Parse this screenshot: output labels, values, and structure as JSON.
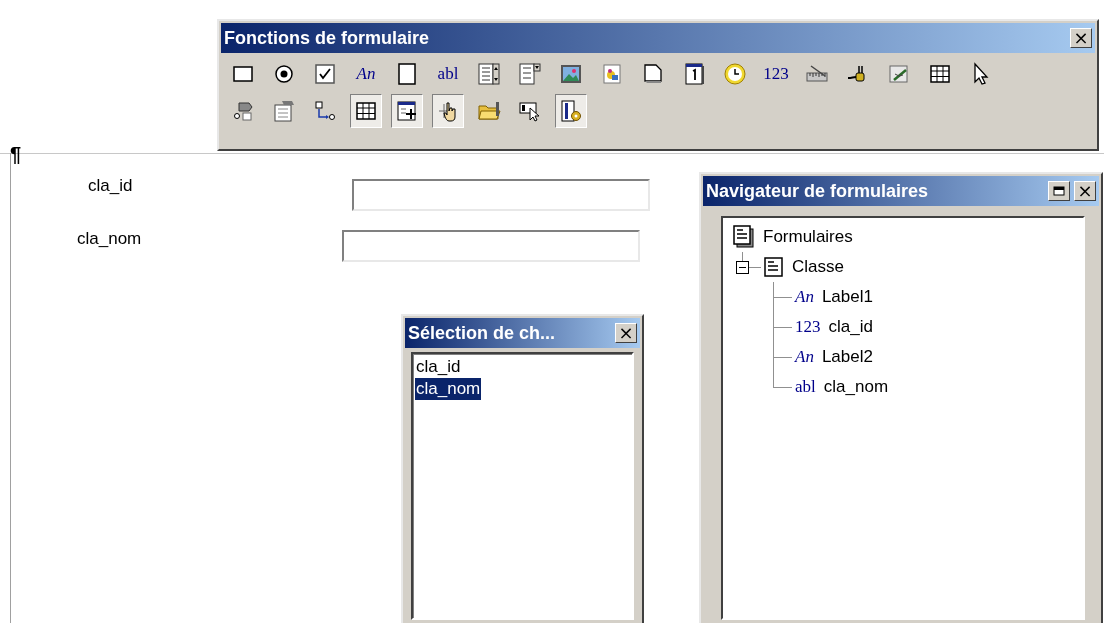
{
  "document": {
    "paragraph_mark": "¶",
    "controls": [
      {
        "label": "cla_id"
      },
      {
        "label": "cla_nom"
      }
    ]
  },
  "toolbar_window": {
    "title": "Fonctions de formulaire",
    "close": "×",
    "rows": [
      [
        {
          "kind": "button",
          "pressed": false
        },
        {
          "kind": "radio",
          "pressed": false
        },
        {
          "kind": "checkbox",
          "pressed": false
        },
        {
          "kind": "glyph",
          "glyph": "An",
          "italic": true,
          "pressed": false
        },
        {
          "kind": "page",
          "pressed": false
        },
        {
          "kind": "glyph",
          "glyph": "abl",
          "italic": false,
          "pressed": false
        },
        {
          "kind": "listbox",
          "pressed": false
        },
        {
          "kind": "combobox",
          "pressed": false
        },
        {
          "kind": "image",
          "pressed": false
        },
        {
          "kind": "photo",
          "pressed": false
        },
        {
          "kind": "document",
          "pressed": false
        },
        {
          "kind": "calendar",
          "pressed": false
        },
        {
          "kind": "clock",
          "pressed": false
        },
        {
          "kind": "glyph",
          "glyph": "123",
          "italic": false,
          "pressed": false
        },
        {
          "kind": "ruler",
          "pressed": false
        },
        {
          "kind": "plug",
          "pressed": false
        },
        {
          "kind": "pen",
          "pressed": false
        },
        {
          "kind": "grid",
          "pressed": false
        },
        {
          "kind": "pointer",
          "pressed": false
        }
      ],
      [
        {
          "kind": "group",
          "pressed": false
        },
        {
          "kind": "properties",
          "pressed": false
        },
        {
          "kind": "order",
          "pressed": false
        },
        {
          "kind": "grid",
          "pressed": true
        },
        {
          "kind": "addfield",
          "pressed": true
        },
        {
          "kind": "hand",
          "pressed": true
        },
        {
          "kind": "folder",
          "pressed": false
        },
        {
          "kind": "focus",
          "pressed": false
        },
        {
          "kind": "navigator",
          "pressed": true
        }
      ]
    ]
  },
  "selection_window": {
    "title": "Sélection de ch...",
    "close": "×",
    "items": [
      {
        "label": "cla_id",
        "selected": false
      },
      {
        "label": "cla_nom",
        "selected": true
      }
    ]
  },
  "navigator_window": {
    "title": "Navigateur de formulaires",
    "close": "×",
    "tree": [
      {
        "label": "Formulaires",
        "kind": "forms",
        "children": [
          {
            "label": "Classe",
            "kind": "form",
            "expanded": true,
            "children": [
              {
                "label": "Label1",
                "glyph": "An",
                "italic": true
              },
              {
                "label": "cla_id",
                "glyph": "123",
                "italic": false
              },
              {
                "label": "Label2",
                "glyph": "An",
                "italic": true
              },
              {
                "label": "cla_nom",
                "glyph": "abl",
                "italic": false
              }
            ]
          }
        ]
      }
    ]
  }
}
